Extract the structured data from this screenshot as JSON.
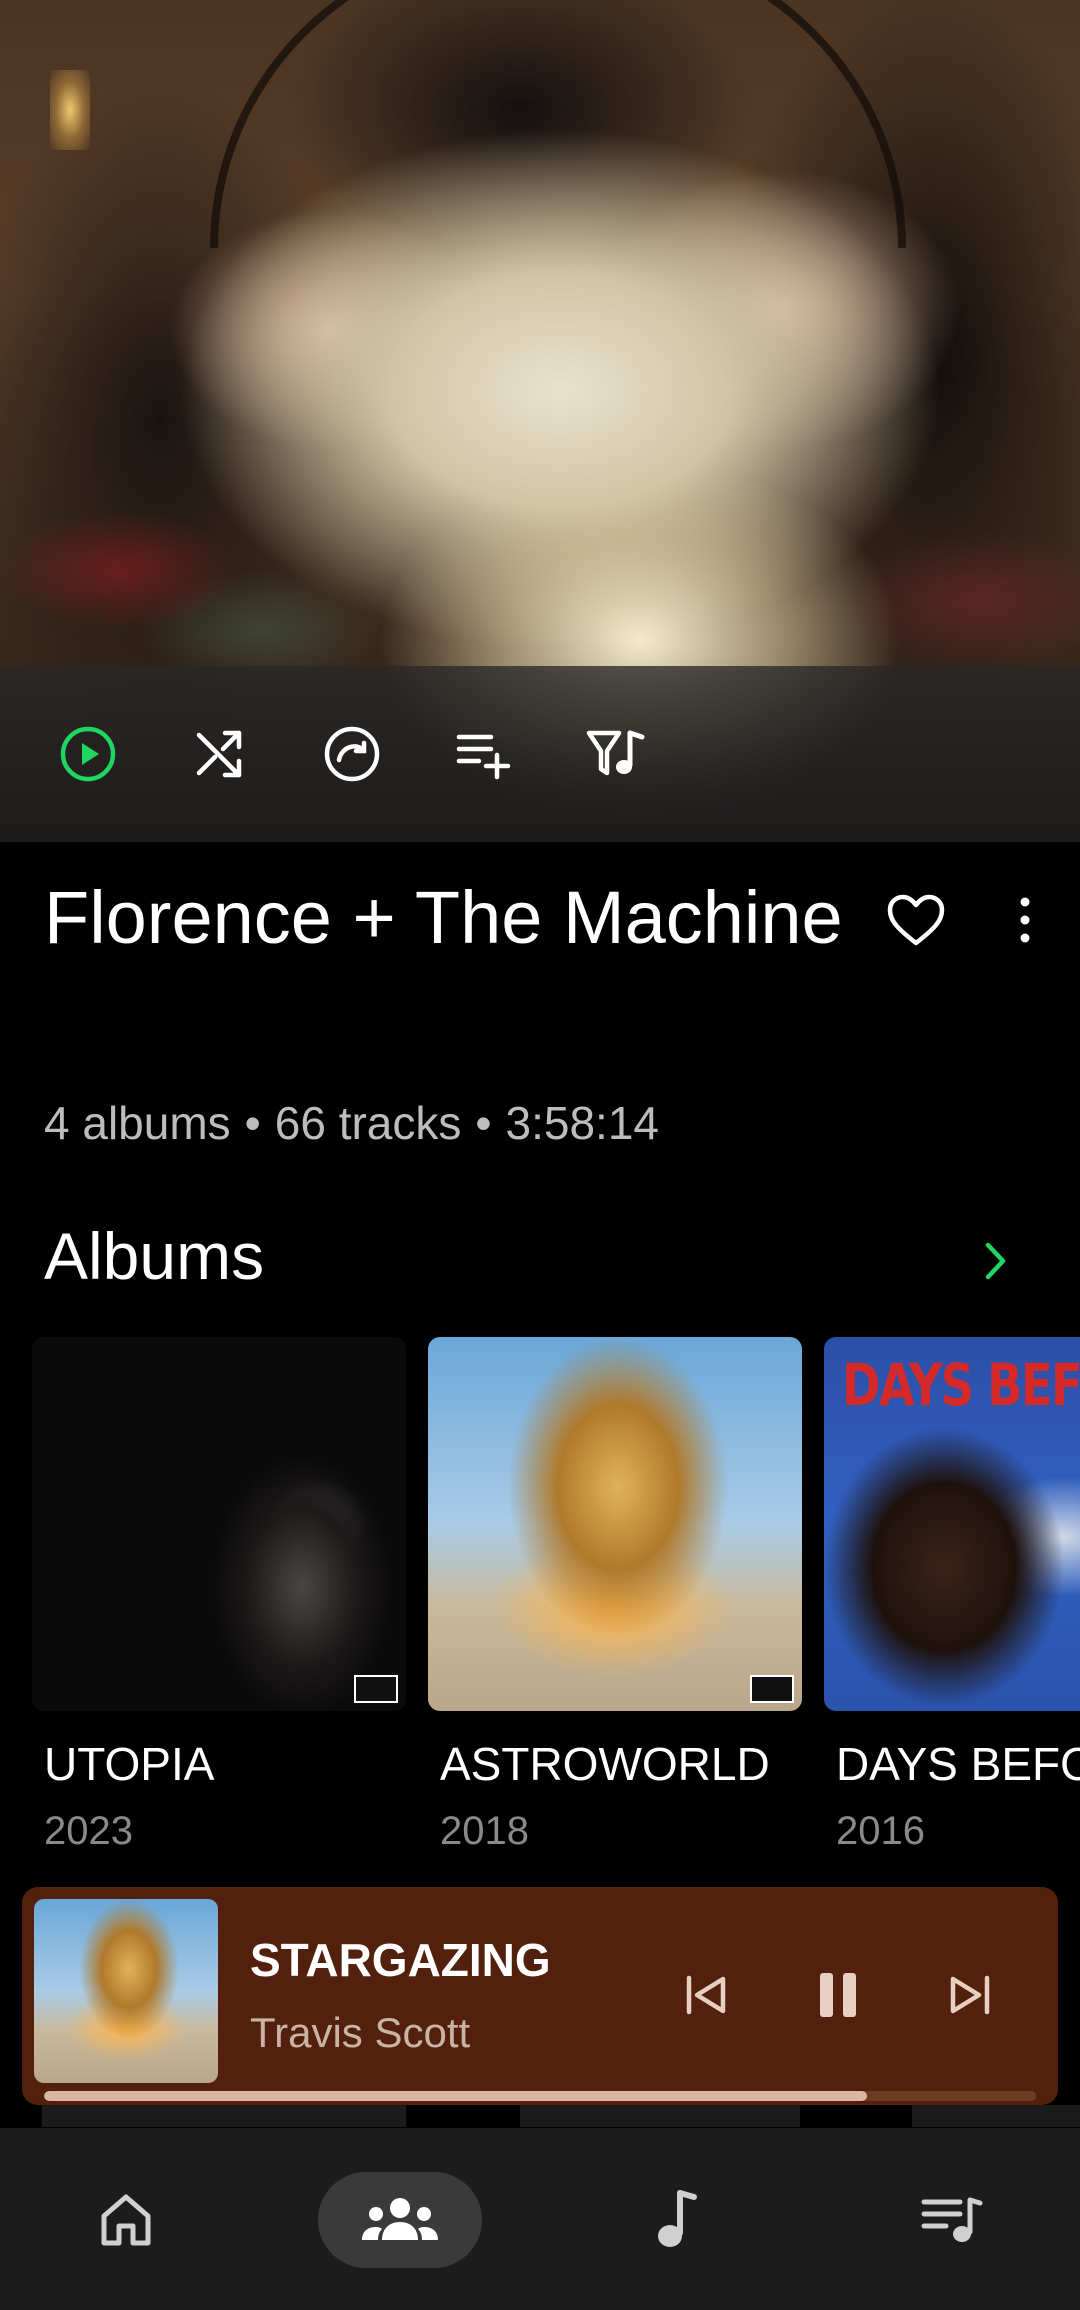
{
  "artist": {
    "name": "Florence + The Machine",
    "stats": {
      "albums": "4 albums",
      "tracks": "66 tracks",
      "duration": "3:58:14",
      "separator": "•"
    }
  },
  "hero_actions": [
    {
      "name": "play",
      "icon": "play-circle-icon"
    },
    {
      "name": "shuffle",
      "icon": "shuffle-icon"
    },
    {
      "name": "radio",
      "icon": "radio-circle-icon"
    },
    {
      "name": "add-to-queue",
      "icon": "playlist-add-icon"
    },
    {
      "name": "filter-music",
      "icon": "music-filter-icon"
    }
  ],
  "albums_section": {
    "title": "Albums",
    "items": [
      {
        "title": "UTOPIA",
        "year": "2023"
      },
      {
        "title": "ASTROWORLD",
        "year": "2018"
      },
      {
        "title": "DAYS BEFORE RODEO",
        "year": "2016",
        "cover_text": "DAYS BEFORE R"
      }
    ]
  },
  "now_playing": {
    "title": "STARGAZING",
    "artist": "Travis Scott",
    "progress": 0.83
  },
  "bottom_nav": [
    {
      "name": "home",
      "icon": "home-icon",
      "active": false
    },
    {
      "name": "artists",
      "icon": "people-icon",
      "active": true
    },
    {
      "name": "tracks",
      "icon": "music-note-icon",
      "active": false
    },
    {
      "name": "queue",
      "icon": "queue-music-icon",
      "active": false
    }
  ],
  "colors": {
    "accent_green": "#1ed760",
    "mini_player_bg": "#52200d",
    "nav_bg": "#1c1c1c",
    "stats_text": "#bdbdbd"
  }
}
